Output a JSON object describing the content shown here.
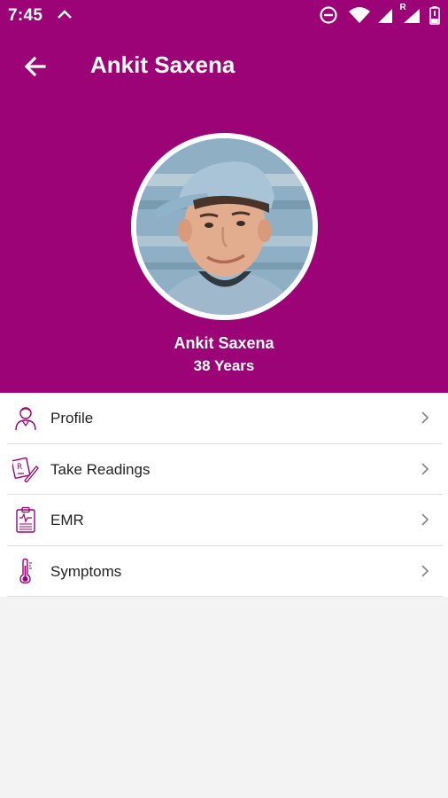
{
  "status_bar": {
    "time": "7:45",
    "icons": [
      "chevron-up-icon",
      "do-not-disturb-icon",
      "wifi-icon",
      "signal-icon",
      "signal-roaming-icon",
      "battery-low-icon"
    ],
    "roaming_label": "R"
  },
  "toolbar": {
    "back_icon": "arrow-left-icon",
    "title": "Ankit Saxena"
  },
  "profile": {
    "name": "Ankit Saxena",
    "age": "38 Years"
  },
  "menu": {
    "items": [
      {
        "label": "Profile",
        "icon": "user-icon"
      },
      {
        "label": "Take Readings",
        "icon": "prescription-icon"
      },
      {
        "label": "EMR",
        "icon": "clipboard-icon"
      },
      {
        "label": "Symptoms",
        "icon": "thermometer-icon"
      }
    ]
  },
  "colors": {
    "primary": "#9c0377",
    "background": "#f3f3f3",
    "surface": "#ffffff",
    "icon_accent": "#9c0377",
    "chevron": "#8a8a8a"
  }
}
